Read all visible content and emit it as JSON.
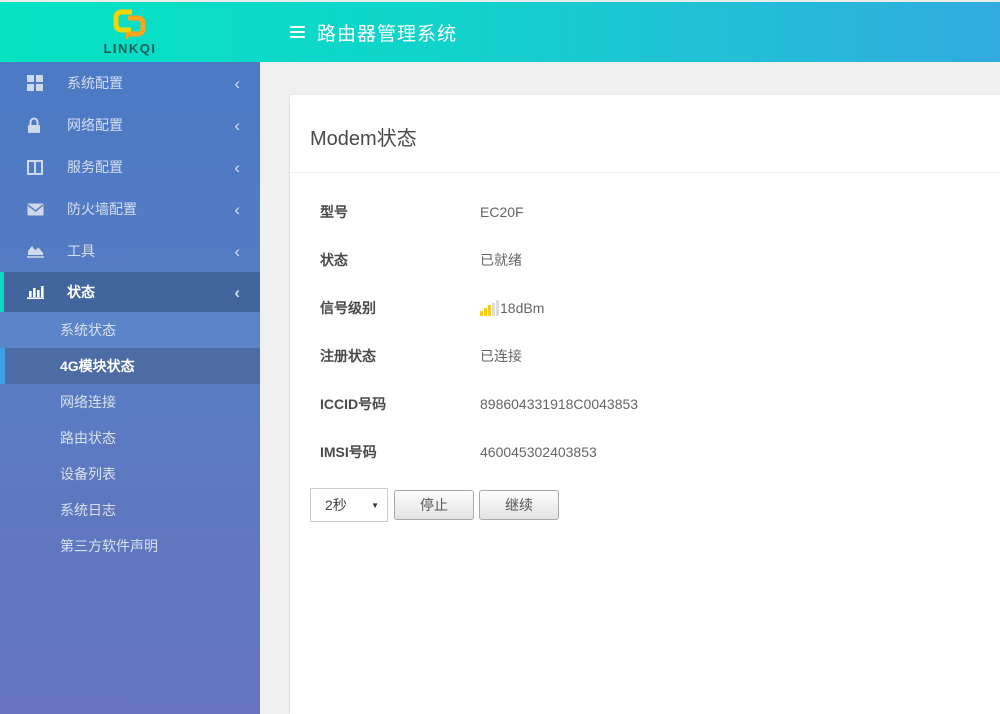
{
  "header": {
    "logo_text": "LINKQI",
    "title": "路由器管理系统"
  },
  "sidebar": {
    "items": [
      {
        "label": "系统配置",
        "icon": "grid-icon",
        "chevron": "‹"
      },
      {
        "label": "网络配置",
        "icon": "lock-icon",
        "chevron": "‹"
      },
      {
        "label": "服务配置",
        "icon": "columns-icon",
        "chevron": "‹"
      },
      {
        "label": "防火墙配置",
        "icon": "envelope-icon",
        "chevron": "‹"
      },
      {
        "label": "工具",
        "icon": "chart-area-icon",
        "chevron": "‹"
      },
      {
        "label": "状态",
        "icon": "bar-chart-icon",
        "chevron": "‹"
      }
    ],
    "submenu": [
      {
        "label": "系统状态"
      },
      {
        "label": "4G模块状态"
      },
      {
        "label": "网络连接"
      },
      {
        "label": "路由状态"
      },
      {
        "label": "设备列表"
      },
      {
        "label": "系统日志"
      },
      {
        "label": "第三方软件声明"
      }
    ]
  },
  "main": {
    "card_title": "Modem状态",
    "rows": [
      {
        "label": "型号",
        "value": "EC20F"
      },
      {
        "label": "状态",
        "value": "已就绪"
      },
      {
        "label": "信号级别",
        "value": "18dBm",
        "icon": "signal-bars-icon"
      },
      {
        "label": "注册状态",
        "value": "已连接"
      },
      {
        "label": "ICCID号码",
        "value": "898604331918C0043853"
      },
      {
        "label": "IMSI号码",
        "value": "460045302403853"
      }
    ],
    "controls": {
      "interval_value": "2秒",
      "stop_label": "停止",
      "continue_label": "继续"
    }
  },
  "colors": {
    "header_gradient_left": "#04e3c2",
    "header_gradient_right": "#31abdf",
    "sidebar_top": "#4b7ac5",
    "sidebar_bottom": "#6673be",
    "active_parent_accent": "#0cd9c3",
    "active_sub_accent": "#3ba0e8",
    "signal_bar_active": "#f8cd12",
    "logo_yellow": "#f5d500",
    "logo_orange": "#ffa31a"
  }
}
